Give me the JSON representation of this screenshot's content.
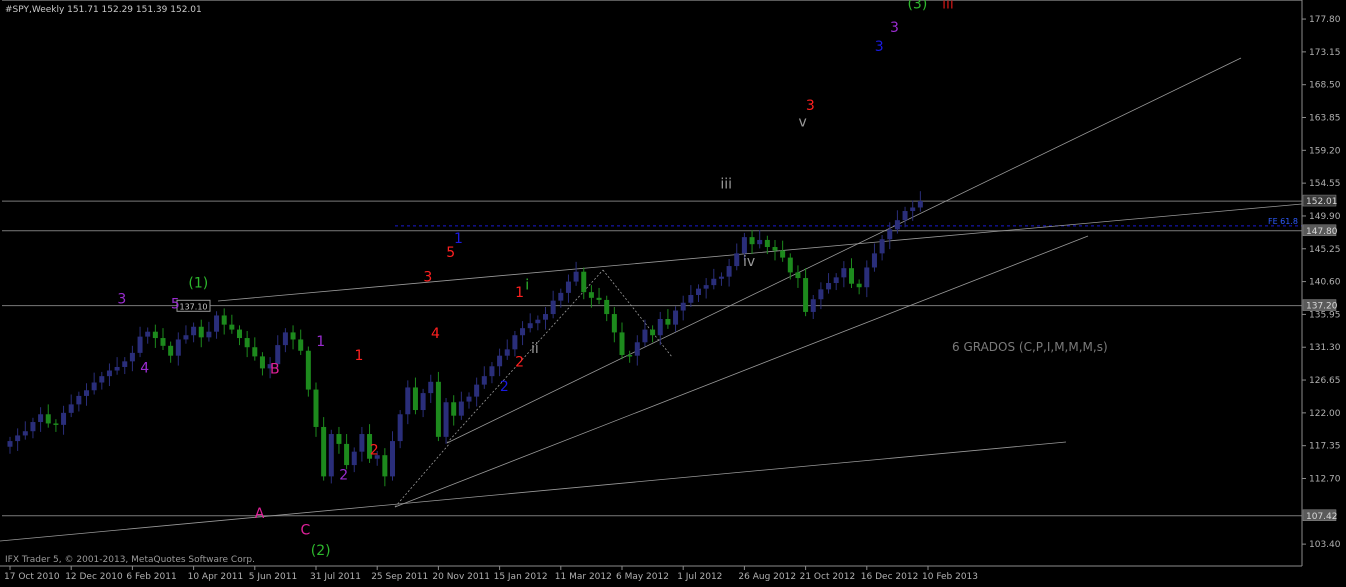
{
  "window": {
    "title": "#SPY,Weekly  151.71 152.29 151.39 152.01"
  },
  "footer": {
    "text": "IFX Trader 5, © 2001-2013, MetaQuotes Software Corp."
  },
  "colors": {
    "background": "#000000",
    "bull": "#2a2e7a",
    "bear": "#1d8a1d",
    "axis": "#8c8c8c",
    "trendline": "#9a9a9a",
    "fe_line": "#1a1ad0",
    "fe_label": "#2e5cff"
  },
  "chart_data": {
    "type": "candlestick",
    "symbol": "#SPY",
    "timeframe": "Weekly",
    "ylim": [
      100.3,
      180.5
    ],
    "yticks": [
      {
        "v": 177.8,
        "t": "177.80"
      },
      {
        "v": 173.15,
        "t": "173.15"
      },
      {
        "v": 168.5,
        "t": "168.50"
      },
      {
        "v": 163.85,
        "t": "163.85"
      },
      {
        "v": 159.2,
        "t": "159.20"
      },
      {
        "v": 154.55,
        "t": "154.55"
      },
      {
        "v": 149.9,
        "t": "149.90"
      },
      {
        "v": 145.25,
        "t": "145.25"
      },
      {
        "v": 140.6,
        "t": "140.60"
      },
      {
        "v": 135.95,
        "t": "135.95"
      },
      {
        "v": 131.3,
        "t": "131.30"
      },
      {
        "v": 126.65,
        "t": "126.65"
      },
      {
        "v": 122.0,
        "t": "122.00"
      },
      {
        "v": 117.35,
        "t": "117.35"
      },
      {
        "v": 112.7,
        "t": "112.70"
      },
      {
        "v": 103.4,
        "t": "103.40"
      }
    ],
    "xticks": [
      {
        "i": 0,
        "t": "17 Oct 2010"
      },
      {
        "i": 8,
        "t": "12 Dec 2010"
      },
      {
        "i": 16,
        "t": "6 Feb 2011"
      },
      {
        "i": 24,
        "t": "10 Apr 2011"
      },
      {
        "i": 32,
        "t": "5 Jun 2011"
      },
      {
        "i": 40,
        "t": "31 Jul 2011"
      },
      {
        "i": 48,
        "t": "25 Sep 2011"
      },
      {
        "i": 56,
        "t": "20 Nov 2011"
      },
      {
        "i": 64,
        "t": "15 Jan 2012"
      },
      {
        "i": 72,
        "t": "11 Mar 2012"
      },
      {
        "i": 80,
        "t": "6 May 2012"
      },
      {
        "i": 88,
        "t": "1 Jul 2012"
      },
      {
        "i": 96,
        "t": "26 Aug 2012"
      },
      {
        "i": 104,
        "t": "21 Oct 2012"
      },
      {
        "i": 112,
        "t": "16 Dec 2012"
      },
      {
        "i": 120,
        "t": "10 Feb 2013"
      }
    ],
    "price_labels": [
      {
        "v": 152.01,
        "t": "152.01",
        "style": "current"
      },
      {
        "v": 147.8,
        "t": "147.80",
        "style": "level"
      },
      {
        "v": 137.2,
        "t": "137.20",
        "style": "level"
      },
      {
        "v": 107.42,
        "t": "107.42",
        "style": "level"
      }
    ],
    "horizontal_levels": [
      152.01,
      147.8,
      137.2,
      107.42
    ],
    "fe_level": {
      "label": "FE 61.8",
      "value": 148.5
    },
    "callout": {
      "label": "137.10",
      "value": 137.1
    },
    "closes": [
      118.0,
      118.8,
      119.4,
      120.7,
      121.8,
      120.5,
      120.3,
      122.0,
      123.2,
      124.4,
      125.2,
      126.3,
      127.2,
      128.0,
      128.5,
      129.3,
      130.5,
      132.8,
      133.5,
      132.6,
      131.5,
      130.1,
      132.4,
      133.0,
      134.2,
      132.7,
      133.5,
      135.8,
      134.5,
      133.8,
      132.6,
      131.3,
      130.0,
      128.3,
      128.9,
      131.6,
      133.4,
      132.4,
      130.8,
      125.3,
      120.0,
      113.0,
      119.0,
      117.6,
      114.6,
      116.5,
      119.0,
      115.5,
      116.0,
      113.0,
      118.0,
      121.8,
      125.6,
      122.4,
      124.8,
      126.4,
      118.6,
      123.5,
      121.6,
      123.6,
      124.3,
      126.0,
      127.2,
      128.6,
      130.1,
      131.0,
      133.0,
      134.0,
      134.7,
      135.2,
      136.0,
      137.9,
      139.0,
      140.6,
      142.0,
      139.1,
      138.3,
      138.0,
      136.0,
      133.4,
      130.2,
      130.1,
      132.0,
      133.8,
      133.0,
      135.3,
      134.5,
      136.5,
      137.6,
      138.7,
      139.6,
      140.1,
      141.0,
      141.3,
      142.8,
      144.6,
      146.9,
      145.9,
      146.5,
      145.5,
      145.0,
      144.0,
      141.9,
      141.1,
      136.3,
      138.1,
      139.5,
      140.4,
      141.2,
      142.5,
      140.3,
      139.8,
      142.6,
      144.6,
      146.6,
      148.0,
      149.3,
      150.6,
      151.1,
      152.01
    ],
    "wave_labels": [
      {
        "t": "(3)",
        "i": 116,
        "y": 180.0,
        "color": "#2db82d"
      },
      {
        "t": "iii",
        "i": 120,
        "y": 180.0,
        "color": "#d01818"
      },
      {
        "t": "3",
        "i": 113,
        "y": 176.7,
        "color": "#9a2cd0"
      },
      {
        "t": "3",
        "i": 111,
        "y": 174.0,
        "color": "#1a1ae0"
      },
      {
        "t": "3",
        "i": 102,
        "y": 165.6,
        "color": "#ff2020"
      },
      {
        "t": "v",
        "i": 101,
        "y": 163.3,
        "color": "#9a9a9a"
      },
      {
        "t": "iii",
        "i": 91,
        "y": 154.5,
        "color": "#9a9a9a"
      },
      {
        "t": "iv",
        "i": 94,
        "y": 143.5,
        "color": "#9a9a9a"
      },
      {
        "t": "(1)",
        "i": 22,
        "y": 140.5,
        "color": "#2db82d"
      },
      {
        "t": "5",
        "i": 19,
        "y": 137.5,
        "color": "#9a2cd0"
      },
      {
        "t": "3",
        "i": 12,
        "y": 138.2,
        "color": "#9a2cd0"
      },
      {
        "t": "4",
        "i": 15,
        "y": 128.4,
        "color": "#9a2cd0"
      },
      {
        "t": "1",
        "i": 38,
        "y": 132.2,
        "color": "#9a2cd0"
      },
      {
        "t": "B",
        "i": 32,
        "y": 128.3,
        "color": "#e0209a"
      },
      {
        "t": "A",
        "i": 30,
        "y": 107.8,
        "color": "#e0209a"
      },
      {
        "t": "C",
        "i": 36,
        "y": 105.5,
        "color": "#e0209a"
      },
      {
        "t": "(2)",
        "i": 38,
        "y": 102.6,
        "color": "#2db82d"
      },
      {
        "t": "1",
        "i": 43,
        "y": 130.2,
        "color": "#ff2020"
      },
      {
        "t": "2",
        "i": 45,
        "y": 116.8,
        "color": "#ff2020"
      },
      {
        "t": "2",
        "i": 41,
        "y": 113.3,
        "color": "#9a2cd0"
      },
      {
        "t": "3",
        "i": 52,
        "y": 141.3,
        "color": "#ff2020"
      },
      {
        "t": "5",
        "i": 55,
        "y": 144.8,
        "color": "#ff2020"
      },
      {
        "t": "1",
        "i": 56,
        "y": 146.8,
        "color": "#1a1ae0"
      },
      {
        "t": "4",
        "i": 53,
        "y": 133.3,
        "color": "#ff2020"
      },
      {
        "t": "1",
        "i": 64,
        "y": 139.1,
        "color": "#ff2020"
      },
      {
        "t": "i",
        "i": 65,
        "y": 140.2,
        "color": "#2db82d"
      },
      {
        "t": "ii",
        "i": 66,
        "y": 131.2,
        "color": "#9a9a9a"
      },
      {
        "t": "2",
        "i": 64,
        "y": 129.3,
        "color": "#ff2020"
      },
      {
        "t": "2",
        "i": 62,
        "y": 125.8,
        "color": "#1a1ae0"
      }
    ],
    "annotation": {
      "t": "6 GRADOS (C,P,I,M,M,M,s)",
      "i": 88,
      "y": 131.3,
      "color": "#7a7a7a"
    }
  }
}
